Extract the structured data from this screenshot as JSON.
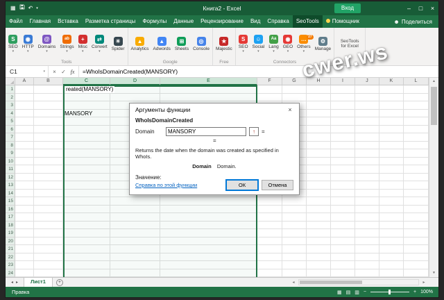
{
  "window": {
    "title": "Книга2 - Excel",
    "login_label": "Вход"
  },
  "watermark": "cwer.ws",
  "icons": {
    "app": "▦",
    "undo": "↶",
    "caret_down": "▾",
    "minimize": "–",
    "maximize": "□",
    "close": "×",
    "check": "✓",
    "fx": "fx",
    "up_arrow": "↑",
    "scroll_up": "▲",
    "scroll_down": "▼",
    "scroll_left": "◂",
    "scroll_right": "▸",
    "plus": "+",
    "minus": "−",
    "person": "☻",
    "view_normal": "▦",
    "view_layout": "▤",
    "view_break": "▥"
  },
  "ribbon": {
    "tabs": [
      {
        "id": "file",
        "label": "Файл"
      },
      {
        "id": "home",
        "label": "Главная"
      },
      {
        "id": "insert",
        "label": "Вставка"
      },
      {
        "id": "page-layout",
        "label": "Разметка страницы"
      },
      {
        "id": "formulas",
        "label": "Формулы"
      },
      {
        "id": "data",
        "label": "Данные"
      },
      {
        "id": "review",
        "label": "Рецензирование"
      },
      {
        "id": "view",
        "label": "Вид"
      },
      {
        "id": "help",
        "label": "Справка"
      },
      {
        "id": "seotools",
        "label": "SeoTools",
        "active": true
      },
      {
        "id": "assistant",
        "label": "Помощник",
        "bulb": true
      }
    ],
    "share_label": "Поделиться",
    "groups": [
      {
        "label": "Tools",
        "buttons": [
          {
            "id": "seo",
            "label": "SEO",
            "glyph": "S",
            "color": "#2f9e5f",
            "caret": true
          },
          {
            "id": "http",
            "label": "HTTP",
            "glyph": "◉",
            "color": "#3a7bd5",
            "caret": true
          },
          {
            "id": "domains",
            "label": "Domains",
            "glyph": "@",
            "color": "#7e57c2",
            "caret": true
          },
          {
            "id": "strings",
            "label": "Strings",
            "glyph": "ab",
            "color": "#ef6c00",
            "caret": true
          },
          {
            "id": "misc",
            "label": "Misc",
            "glyph": "+",
            "color": "#d32f2f",
            "caret": true
          },
          {
            "id": "convert",
            "label": "Convert",
            "glyph": "⇄",
            "color": "#00897b",
            "caret": true
          },
          {
            "id": "spider",
            "label": "Spider",
            "glyph": "☀",
            "color": "#37474f",
            "caret": false
          }
        ]
      },
      {
        "label": "Google",
        "buttons": [
          {
            "id": "analytics",
            "label": "Analytics",
            "glyph": "▲",
            "color": "#f9ab00",
            "caret": false
          },
          {
            "id": "adwords",
            "label": "Adwords",
            "glyph": "▲",
            "color": "#4285f4",
            "caret": false
          },
          {
            "id": "sheets",
            "label": "Sheets",
            "glyph": "⊞",
            "color": "#0f9d58",
            "caret": false
          },
          {
            "id": "console",
            "label": "Console",
            "glyph": "◎",
            "color": "#4683ea",
            "caret": false
          }
        ]
      },
      {
        "label": "Free",
        "buttons": [
          {
            "id": "majestic",
            "label": "Majestic",
            "glyph": "★",
            "color": "#c62828",
            "caret": false
          }
        ]
      },
      {
        "label": "Connectors",
        "buttons": [
          {
            "id": "seo-connector",
            "label": "SEO",
            "glyph": "S",
            "color": "#e53935",
            "caret": true
          },
          {
            "id": "social",
            "label": "Social",
            "glyph": "☺",
            "color": "#1da1f2",
            "caret": true
          },
          {
            "id": "lang",
            "label": "Lang",
            "glyph": "Aa",
            "color": "#43a047",
            "caret": true
          },
          {
            "id": "geo",
            "label": "GEO",
            "glyph": "◉",
            "color": "#e53935",
            "caret": true
          },
          {
            "id": "others",
            "label": "Others",
            "glyph": "…",
            "color": "#fb8c00",
            "caret": true,
            "badge": "27"
          },
          {
            "id": "manage",
            "label": "Manage",
            "glyph": "⚙",
            "color": "#607d8b",
            "caret": false
          }
        ]
      },
      {
        "label": "",
        "buttons": [
          {
            "id": "seotools-for-excel",
            "label": "SeoTools for Excel",
            "twoline": true
          }
        ]
      }
    ]
  },
  "formula_bar": {
    "name_box": "C1",
    "formula": "=WhoIsDomainCreated(MANSORY)"
  },
  "grid": {
    "columns": [
      "A",
      "B",
      "C",
      "D",
      "E",
      "F",
      "G",
      "H",
      "I",
      "J",
      "K",
      "L"
    ],
    "selected_columns": [
      "C",
      "D",
      "E"
    ],
    "row_count": 24,
    "cells": [
      {
        "ref": "C1",
        "text": "reated(MANSORY)",
        "edit": true
      },
      {
        "ref": "C4",
        "text": "MANSORY"
      }
    ]
  },
  "dialog": {
    "title": "Аргументы функции",
    "function_name": "WhoIsDomainCreated",
    "field_label": "Domain",
    "field_value": "MANSORY",
    "equals": "=",
    "result_equals": "=",
    "description": "Returns the date when the domain was created as specified in WhoIs.",
    "param_name": "Domain",
    "param_desc": "Domain.",
    "value_label": "Значение:",
    "help_link": "Справка по этой функции",
    "ok_label": "ОК",
    "cancel_label": "Отмена"
  },
  "sheet_bar": {
    "tabs": [
      {
        "label": "Лист1",
        "active": true
      }
    ]
  },
  "status_bar": {
    "mode": "Правка",
    "zoom": "100%"
  }
}
